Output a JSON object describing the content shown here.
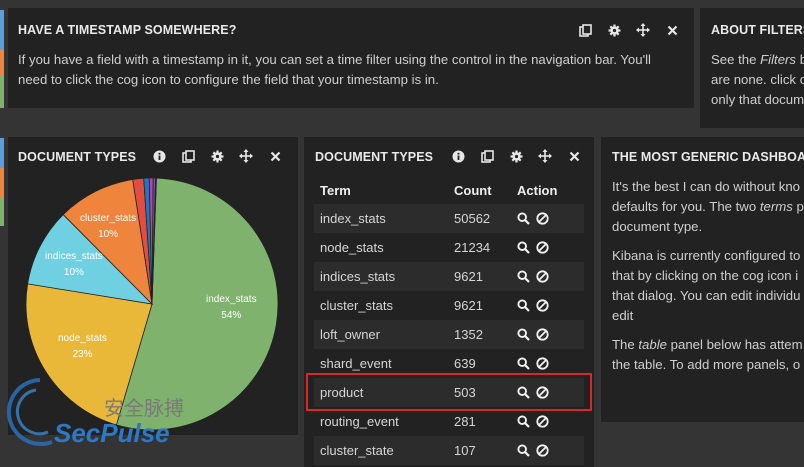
{
  "timestamp_panel": {
    "title": "HAVE A TIMESTAMP SOMEWHERE?",
    "line1": "If you have a field with a timestamp in it, you can set a time filter using the control in the navigation bar. You'll",
    "line2": "need to click the cog icon to configure the field that your timestamp is in."
  },
  "filters_panel": {
    "title": "ABOUT FILTERS",
    "line1": "See the Filters b",
    "line2": "are none. click o",
    "line3": "only that docum"
  },
  "pie_panel": {
    "title": "DOCUMENT TYPES",
    "labels": [
      {
        "name": "index_stats",
        "pct": "54%"
      },
      {
        "name": "node_stats",
        "pct": "23%"
      },
      {
        "name": "indices_stats",
        "pct": "10%"
      },
      {
        "name": "cluster_stats",
        "pct": "10%"
      }
    ]
  },
  "chart_data": {
    "type": "pie",
    "title": "DOCUMENT TYPES",
    "slices": [
      {
        "label": "index_stats",
        "value": 54,
        "color": "#7eb26d"
      },
      {
        "label": "node_stats",
        "value": 23,
        "color": "#eab839"
      },
      {
        "label": "indices_stats",
        "value": 10,
        "color": "#6ed0e0"
      },
      {
        "label": "cluster_stats",
        "value": 10,
        "color": "#ef843c"
      },
      {
        "label": "loft_owner",
        "value": 1.4,
        "color": "#e24d42"
      },
      {
        "label": "shard_event",
        "value": 0.7,
        "color": "#1f78c1"
      },
      {
        "label": "product",
        "value": 0.5,
        "color": "#ba43a9"
      },
      {
        "label": "routing_event",
        "value": 0.3,
        "color": "#705da0"
      },
      {
        "label": "cluster_state",
        "value": 0.1,
        "color": "#508642"
      }
    ]
  },
  "terms_panel": {
    "title": "DOCUMENT TYPES",
    "headers": {
      "term": "Term",
      "count": "Count",
      "action": "Action"
    },
    "rows": [
      {
        "term": "index_stats",
        "count": "50562"
      },
      {
        "term": "node_stats",
        "count": "21234"
      },
      {
        "term": "indices_stats",
        "count": "9621"
      },
      {
        "term": "cluster_stats",
        "count": "9621"
      },
      {
        "term": "loft_owner",
        "count": "1352"
      },
      {
        "term": "shard_event",
        "count": "639"
      },
      {
        "term": "product",
        "count": "503"
      },
      {
        "term": "routing_event",
        "count": "281"
      },
      {
        "term": "cluster_state",
        "count": "107"
      }
    ],
    "highlight_color": "#d9272a"
  },
  "generic_panel": {
    "title": "THE MOST GENERIC DASHBOA",
    "p1_l1": "It's the best I can do without kno",
    "p1_l2a": "defaults for you. The two ",
    "p1_l2_em": "terms",
    "p1_l2b": " p",
    "p1_l3": "document type.",
    "p2_l1": "Kibana is currently configured to",
    "p2_l2": "that by clicking on the cog icon i",
    "p2_l3": "that dialog. You can edit individu",
    "p2_l4": "edit",
    "p3_l1a": "The ",
    "p3_l1_em": "table",
    "p3_l1b": " panel below has attem",
    "p3_l2": "the table. To add more panels, o"
  },
  "watermark": {
    "cn": "安全脉搏",
    "en": "SecPulse"
  },
  "colors": {
    "background": "#343434",
    "panel": "#222222",
    "stripe_blue": "#5aa0e0",
    "stripe_orange": "#ef843c",
    "stripe_green": "#7eb26d"
  },
  "icons": [
    "info-icon",
    "duplicate-icon",
    "cog-icon",
    "move-icon",
    "close-icon",
    "search-icon",
    "ban-icon"
  ]
}
